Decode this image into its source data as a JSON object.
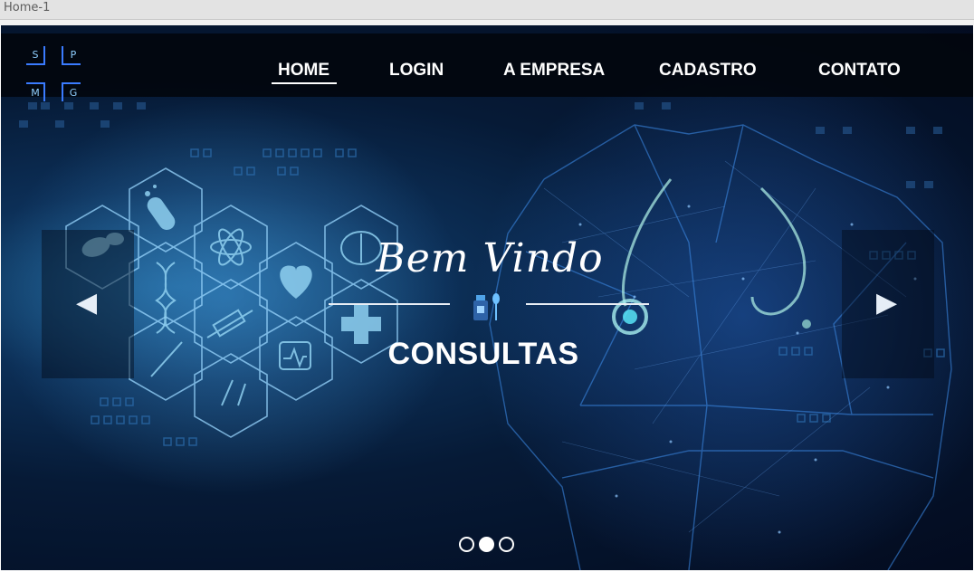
{
  "window": {
    "tab_title": "Home-1"
  },
  "logo": {
    "letters": [
      "S",
      "P",
      "M",
      "G"
    ],
    "color": "#3a7bff"
  },
  "nav": {
    "items": [
      {
        "label": "HOME",
        "active": true
      },
      {
        "label": "LOGIN",
        "active": false
      },
      {
        "label": "A EMPRESA",
        "active": false
      },
      {
        "label": "CADASTRO",
        "active": false
      },
      {
        "label": "CONTATO",
        "active": false
      }
    ]
  },
  "hero": {
    "welcome_text": "Bem Vindo",
    "headline": "CONSULTAS",
    "prev_icon": "triangle-left",
    "next_icon": "triangle-right",
    "slides_total": 3,
    "active_slide": 2
  },
  "colors": {
    "navbar_bg": "#02060e",
    "hero_bg": "#061a36",
    "accent": "#1e90ff",
    "text": "#ffffff"
  }
}
